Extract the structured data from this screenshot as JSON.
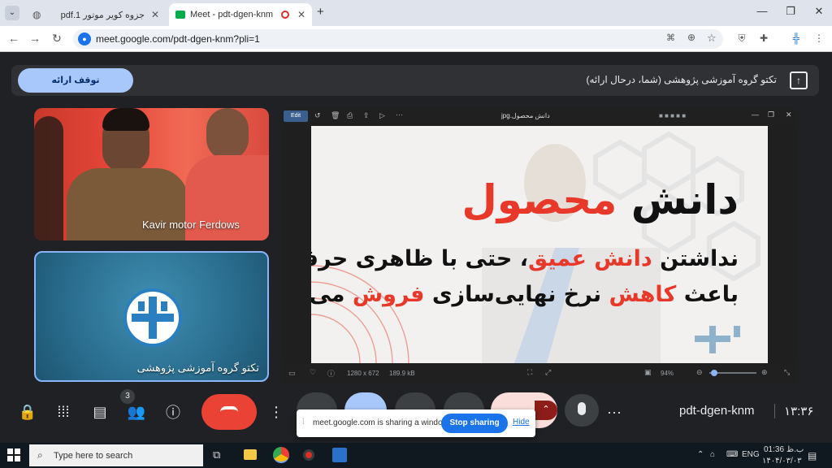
{
  "browser": {
    "tabs": [
      {
        "title": "جزوه کویر موتور pdf.1",
        "active": false
      },
      {
        "title": "Meet - pdt-dgen-knm",
        "active": true
      }
    ],
    "new_tab_label": "+",
    "url": "meet.google.com/pdt-dgen-knm?pli=1"
  },
  "meet": {
    "banner": {
      "title": "تکتو گروه آموزشی پژوهشی (شما، درحال ارائه)",
      "stop_presenting_label": "توقف ارائه"
    },
    "participants": [
      {
        "name": "Kavir motor Ferdows"
      },
      {
        "name": "تکتو گروه آموزشی پژوهشی"
      }
    ],
    "presentation": {
      "viewer_title": "دانش محصول.jpg",
      "edit_label": "Edit",
      "image_info": "1280 x 672",
      "file_size": "189.9 kB",
      "zoom": "94%",
      "slide": {
        "heading_part1": "دانش",
        "heading_part2": "محصول",
        "line1_part1": "نداشتن",
        "line1_part2": "دانش عمیق",
        "line1_part3": "، حتی با ظاهری حرفه‌ای",
        "line2_part1": "باعث",
        "line2_part2": "کاهش",
        "line2_part3": "نرخ نهایی‌سازی",
        "line2_part4": "فروش",
        "line2_part5": "می‌شود"
      }
    },
    "meeting_code": "pdt-dgen-knm",
    "clock": "۱۳:۳۶",
    "people_count": "3",
    "share_notice": {
      "text": "meet.google.com is sharing a window.",
      "stop_label": "Stop sharing",
      "hide_label": "Hide"
    }
  },
  "taskbar": {
    "search_placeholder": "Type here to search",
    "lang": "ENG",
    "time": "01:36 ب.ظ",
    "date": "۱۴۰۴/۰۳/۰۳"
  },
  "colors": {
    "accent": "#1a73e8",
    "slide_red": "#e8382a",
    "end_call": "#ea4335"
  }
}
